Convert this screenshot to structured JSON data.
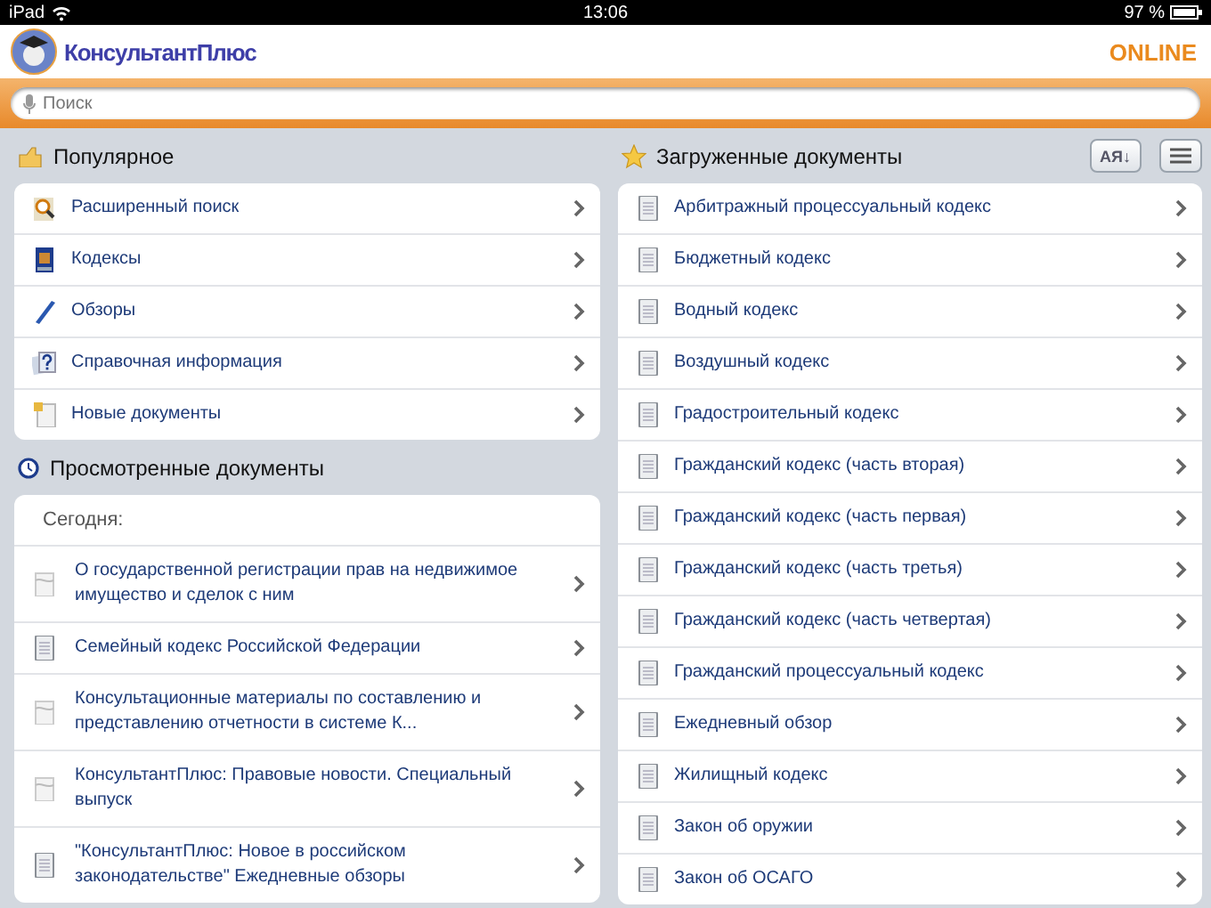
{
  "status_bar": {
    "device": "iPad",
    "time": "13:06",
    "battery": "97 %"
  },
  "header": {
    "app_name": "КонсультантПлюс",
    "mode": "ONLINE"
  },
  "search": {
    "placeholder": "Поиск"
  },
  "popular": {
    "title": "Популярное",
    "items": [
      {
        "label": "Расширенный поиск",
        "kind": "search"
      },
      {
        "label": "Кодексы",
        "kind": "book"
      },
      {
        "label": "Обзоры",
        "kind": "pen"
      },
      {
        "label": "Справочная информация",
        "kind": "help"
      },
      {
        "label": "Новые документы",
        "kind": "new"
      }
    ]
  },
  "viewed": {
    "title": "Просмотренные документы",
    "group": "Сегодня:",
    "items": [
      {
        "label": "О государственной регистрации прав на недвижимое имущество и сделок с ним",
        "kind": "web"
      },
      {
        "label": "Семейный кодекс Российской Федерации",
        "kind": "doc"
      },
      {
        "label": "Консультационные материалы по составлению и представлению отчетности в системе К...",
        "kind": "web"
      },
      {
        "label": "КонсультантПлюс: Правовые новости. Специальный выпуск",
        "kind": "web"
      },
      {
        "label": "\"КонсультантПлюс: Новое в российском законодательстве\" Ежедневные обзоры",
        "kind": "doc"
      }
    ]
  },
  "downloaded": {
    "title": "Загруженные документы",
    "sort_button": "АЯ↓",
    "items": [
      "Арбитражный процессуальный кодекс",
      "Бюджетный кодекс",
      "Водный кодекс",
      "Воздушный кодекс",
      "Градостроительный кодекс",
      "Гражданский кодекс (часть вторая)",
      "Гражданский кодекс (часть первая)",
      "Гражданский кодекс (часть третья)",
      "Гражданский кодекс (часть четвертая)",
      "Гражданский процессуальный кодекс",
      "Ежедневный обзор",
      "Жилищный кодекс",
      "Закон об оружии",
      "Закон об ОСАГО"
    ]
  }
}
